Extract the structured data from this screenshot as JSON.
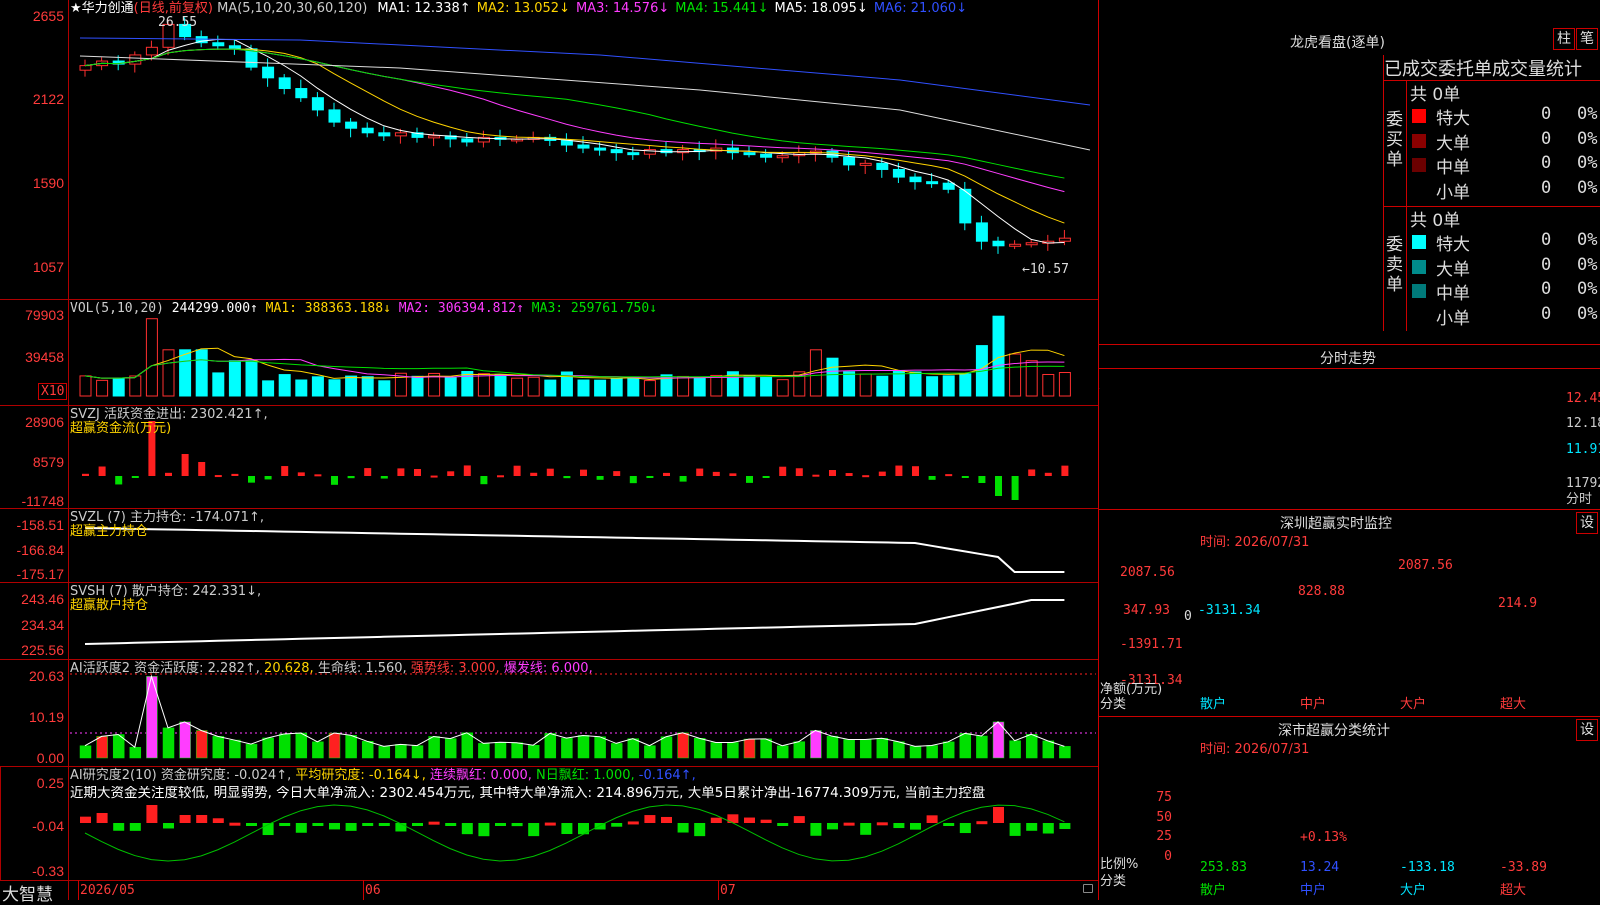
{
  "main": {
    "stock_name": "华力创通",
    "period": "(日线,前复权)",
    "ma_label": "MA(5,10,20,30,60,120)",
    "ma": [
      {
        "name": "MA1",
        "value": "12.338↑",
        "color": "#ffffff"
      },
      {
        "name": "MA2",
        "value": "13.052↓",
        "color": "#ffd400"
      },
      {
        "name": "MA3",
        "value": "14.576↓",
        "color": "#ff3dff"
      },
      {
        "name": "MA4",
        "value": "15.441↓",
        "color": "#00e000"
      },
      {
        "name": "MA5",
        "value": "18.095↓",
        "color": "#ffffff"
      },
      {
        "name": "MA6",
        "value": "21.060↓",
        "color": "#3050ff"
      }
    ],
    "y_ticks": [
      "2655",
      "2122",
      "1590",
      "1057"
    ],
    "high_mark": "26.55",
    "low_mark": "←10.57"
  },
  "vol": {
    "label": "VOL(5,10,20)",
    "value": "244299.000↑",
    "ma1": "MA1: 388363.188↓",
    "ma2": "MA2: 306394.812↑",
    "ma3": "MA3: 259761.750↓",
    "y_ticks": [
      "79903",
      "39458"
    ],
    "unit": "X10"
  },
  "svzj": {
    "label": "SVZJ",
    "line1": "活跃资金进出: 2302.421↑,",
    "line2": "超赢资金流(万元)",
    "y_ticks": [
      "28906",
      "8579",
      "-11748"
    ]
  },
  "svzl": {
    "label": "SVZL (7)",
    "line1": "主力持仓: -174.071↑,",
    "line2": "超赢主力持仓",
    "y_ticks": [
      "-158.51",
      "-166.84",
      "-175.17"
    ]
  },
  "svsh": {
    "label": "SVSH (7)",
    "line1": "散户持仓: 242.331↓,",
    "line2": "超赢散户持仓",
    "y_ticks": [
      "243.46",
      "234.34",
      "225.56"
    ]
  },
  "ai_active": {
    "label": "AI活跃度2",
    "line1": "资金活跃度: 2.282↑,",
    "v2": "20.628,",
    "life": "生命线: 1.560,",
    "strong": "强势线: 3.000,",
    "burst": "爆发线: 6.000,",
    "y_ticks": [
      "20.63",
      "10.19",
      "0.00"
    ]
  },
  "ai_research": {
    "label": "AI研究度2(10)",
    "research": "资金研究度: -0.024↑,",
    "avg": "平均研究度: -0.164↓,",
    "cont": "连续飘红: 0.000,",
    "nday": "N日飘红: 1.000,",
    "last": "-0.164↑,",
    "comment": "近期大资金关注度较低, 明显弱势, 今日大单净流入: 2302.454万元, 其中特大单净流入: 214.896万元, 大单5日累计净出-16774.309万元, 当前主力控盘",
    "y_ticks": [
      "0.25",
      "-0.04",
      "-0.33"
    ]
  },
  "bottom_bar": {
    "brand": "大智慧",
    "dates": [
      "2026/05",
      "06",
      "07"
    ]
  },
  "longhu": {
    "title": "龙虎看盘(逐单)",
    "btn1": "柱",
    "btn2": "笔",
    "header": "已成交委托单成交量统计",
    "buy_label": "委买单",
    "sell_label": "委卖单",
    "buy_total": "共 0单",
    "sell_total": "共 0单",
    "buy_rows": [
      {
        "name": "特大",
        "count": "0",
        "pct": "0%",
        "color": "#ff0000"
      },
      {
        "name": "大单",
        "count": "0",
        "pct": "0%",
        "color": "#8b0000"
      },
      {
        "name": "中单",
        "count": "0",
        "pct": "0%",
        "color": "#6b0000"
      },
      {
        "name": "小单",
        "count": "0",
        "pct": "0%",
        "color": "#000000"
      }
    ],
    "sell_rows": [
      {
        "name": "特大",
        "count": "0",
        "pct": "0%",
        "color": "#00ffff"
      },
      {
        "name": "大单",
        "count": "0",
        "pct": "0%",
        "color": "#008b8b"
      },
      {
        "name": "中单",
        "count": "0",
        "pct": "0%",
        "color": "#007a7a"
      },
      {
        "name": "小单",
        "count": "0",
        "pct": "0%",
        "color": "#000000"
      }
    ]
  },
  "intraday": {
    "title": "分时走势",
    "y_ticks": [
      "12.45",
      "12.18",
      "11.91",
      "11792"
    ],
    "unit": "分时"
  },
  "monitor": {
    "title": "深圳超赢实时监控",
    "btn": "设",
    "time": "时间: 2026/07/31",
    "y_ticks": [
      "2087.56",
      "347.93",
      "-1391.71",
      "-3131.34"
    ],
    "zero": "0",
    "net_label": "净额(万元)",
    "cat_label": "分类",
    "bars": [
      {
        "name": "散户",
        "value": -3131.34,
        "label": "-3131.34"
      },
      {
        "name": "中户",
        "value": 828.88,
        "label": "828.88"
      },
      {
        "name": "大户",
        "value": 2087.56,
        "label": "2087.56"
      },
      {
        "name": "超大",
        "value": 214.9,
        "label": "214.9"
      }
    ]
  },
  "category": {
    "title": "深市超赢分类统计",
    "btn": "设",
    "time": "时间: 2026/07/31",
    "y_ticks": [
      "75",
      "50",
      "25",
      "0"
    ],
    "ratio_label": "比例%",
    "cat_label": "分类",
    "small_label": "+0.13%",
    "items": [
      {
        "name": "散户",
        "value": "253.83"
      },
      {
        "name": "中户",
        "value": "13.24"
      },
      {
        "name": "大户",
        "value": "-133.18"
      },
      {
        "name": "超大",
        "value": "-33.89"
      }
    ]
  }
}
